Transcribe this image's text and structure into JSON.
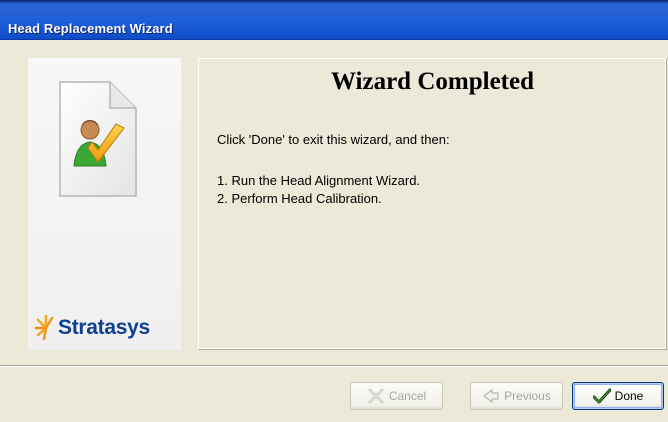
{
  "window": {
    "title": "Head Replacement Wizard"
  },
  "sidebar": {
    "logo_text": "Stratasys",
    "icon": "document-user-check-icon"
  },
  "main": {
    "heading": "Wizard Completed",
    "intro": "Click 'Done' to exit this wizard, and then:",
    "steps": [
      "1. Run the Head Alignment Wizard.",
      "2. Perform Head Calibration."
    ]
  },
  "buttons": {
    "cancel": {
      "label": "Cancel",
      "enabled": false,
      "icon": "x-icon"
    },
    "previous": {
      "label": "Previous",
      "enabled": false,
      "icon": "back-arrow-icon"
    },
    "done": {
      "label": "Done",
      "enabled": true,
      "icon": "checkmark-icon"
    }
  },
  "colors": {
    "titlebar": "#0f4bc6",
    "logo_text": "#0d3f93",
    "checkmark": "#2a9a1a"
  }
}
